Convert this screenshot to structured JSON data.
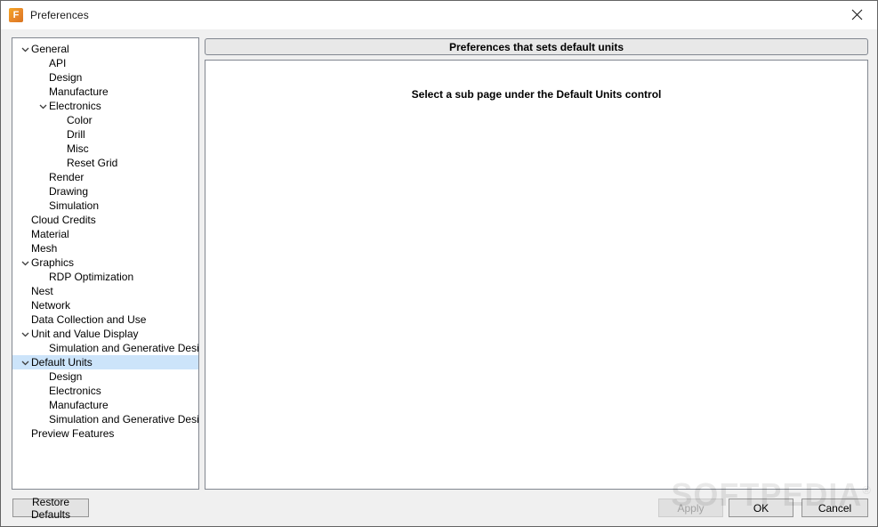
{
  "window": {
    "title": "Preferences",
    "app_icon": "fusion-f-icon",
    "close_icon": "close-icon"
  },
  "tree": {
    "items": [
      {
        "label": "General",
        "level": 0,
        "arrow": "chevron-down-icon",
        "selected": false
      },
      {
        "label": "API",
        "level": 1,
        "arrow": "",
        "selected": false
      },
      {
        "label": "Design",
        "level": 1,
        "arrow": "",
        "selected": false
      },
      {
        "label": "Manufacture",
        "level": 1,
        "arrow": "",
        "selected": false
      },
      {
        "label": "Electronics",
        "level": 1,
        "arrow": "chevron-down-icon",
        "selected": false
      },
      {
        "label": "Color",
        "level": 2,
        "arrow": "",
        "selected": false
      },
      {
        "label": "Drill",
        "level": 2,
        "arrow": "",
        "selected": false
      },
      {
        "label": "Misc",
        "level": 2,
        "arrow": "",
        "selected": false
      },
      {
        "label": "Reset Grid",
        "level": 2,
        "arrow": "",
        "selected": false
      },
      {
        "label": "Render",
        "level": 1,
        "arrow": "",
        "selected": false
      },
      {
        "label": "Drawing",
        "level": 1,
        "arrow": "",
        "selected": false
      },
      {
        "label": "Simulation",
        "level": 1,
        "arrow": "",
        "selected": false
      },
      {
        "label": "Cloud Credits",
        "level": 0,
        "arrow": "",
        "selected": false
      },
      {
        "label": "Material",
        "level": 0,
        "arrow": "",
        "selected": false
      },
      {
        "label": "Mesh",
        "level": 0,
        "arrow": "",
        "selected": false
      },
      {
        "label": "Graphics",
        "level": 0,
        "arrow": "chevron-down-icon",
        "selected": false
      },
      {
        "label": "RDP Optimization",
        "level": 1,
        "arrow": "",
        "selected": false
      },
      {
        "label": "Nest",
        "level": 0,
        "arrow": "",
        "selected": false
      },
      {
        "label": "Network",
        "level": 0,
        "arrow": "",
        "selected": false
      },
      {
        "label": "Data Collection and Use",
        "level": 0,
        "arrow": "",
        "selected": false
      },
      {
        "label": "Unit and Value Display",
        "level": 0,
        "arrow": "chevron-down-icon",
        "selected": false
      },
      {
        "label": "Simulation and Generative Design",
        "level": 1,
        "arrow": "",
        "selected": false
      },
      {
        "label": "Default Units",
        "level": 0,
        "arrow": "chevron-down-icon",
        "selected": true
      },
      {
        "label": "Design",
        "level": 1,
        "arrow": "",
        "selected": false
      },
      {
        "label": "Electronics",
        "level": 1,
        "arrow": "",
        "selected": false
      },
      {
        "label": "Manufacture",
        "level": 1,
        "arrow": "",
        "selected": false
      },
      {
        "label": "Simulation and Generative Design",
        "level": 1,
        "arrow": "",
        "selected": false
      },
      {
        "label": "Preview Features",
        "level": 0,
        "arrow": "",
        "selected": false
      }
    ]
  },
  "main": {
    "header_title": "Preferences that sets default units",
    "message": "Select a sub page under the Default Units control"
  },
  "footer": {
    "restore_defaults_label": "Restore Defaults",
    "apply_label": "Apply",
    "apply_enabled": false,
    "ok_label": "OK",
    "cancel_label": "Cancel"
  },
  "watermark": {
    "text": "SOFTPEDIA",
    "registered_mark": "®"
  },
  "colors": {
    "selection": "#cce4fa",
    "dialog_background": "#f0f0f0",
    "panel_background": "#ffffff",
    "border": "#828790",
    "accent": "#e8882a"
  }
}
